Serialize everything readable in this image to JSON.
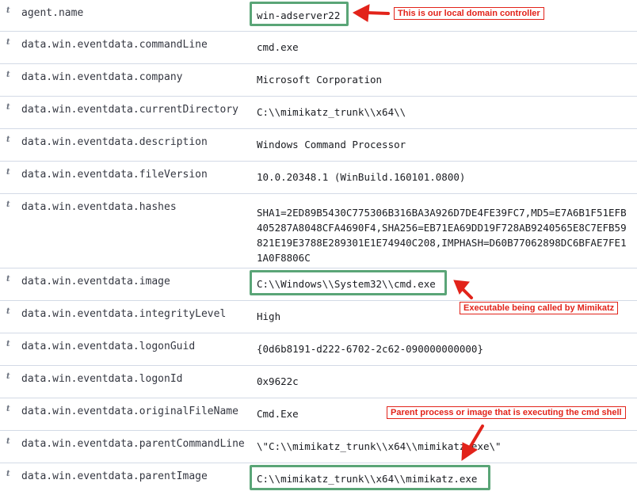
{
  "type_icon": "t",
  "rows": [
    {
      "field": "agent.name",
      "value": "win-adserver22"
    },
    {
      "field": "data.win.eventdata.commandLine",
      "value": "cmd.exe"
    },
    {
      "field": "data.win.eventdata.company",
      "value": "Microsoft Corporation"
    },
    {
      "field": "data.win.eventdata.currentDirectory",
      "value": "C:\\\\mimikatz_trunk\\\\x64\\\\"
    },
    {
      "field": "data.win.eventdata.description",
      "value": "Windows Command Processor"
    },
    {
      "field": "data.win.eventdata.fileVersion",
      "value": "10.0.20348.1 (WinBuild.160101.0800)"
    },
    {
      "field": "data.win.eventdata.hashes",
      "value": "SHA1=2ED89B5430C775306B316BA3A926D7DE4FE39FC7,MD5=E7A6B1F51EFB405287A8048CFA4690F4,SHA256=EB71EA69DD19F728AB9240565E8C7EFB59821E19E3788E289301E1E74940C208,IMPHASH=D60B77062898DC6BFAE7FE11A0F8806C"
    },
    {
      "field": "data.win.eventdata.image",
      "value": "C:\\\\Windows\\\\System32\\\\cmd.exe"
    },
    {
      "field": "data.win.eventdata.integrityLevel",
      "value": "High"
    },
    {
      "field": "data.win.eventdata.logonGuid",
      "value": "{0d6b8191-d222-6702-2c62-090000000000}"
    },
    {
      "field": "data.win.eventdata.logonId",
      "value": "0x9622c"
    },
    {
      "field": "data.win.eventdata.originalFileName",
      "value": "Cmd.Exe"
    },
    {
      "field": "data.win.eventdata.parentCommandLine",
      "value": "\\\"C:\\\\mimikatz_trunk\\\\x64\\\\mimikatz.exe\\\""
    },
    {
      "field": "data.win.eventdata.parentImage",
      "value": "C:\\\\mimikatz_trunk\\\\x64\\\\mimikatz.exe"
    }
  ],
  "annotations": {
    "domain_controller": "This is our local domain controller",
    "executable": "Executable being called by Mimikatz",
    "parent_process": "Parent process or image that is executing the cmd shell"
  },
  "colors": {
    "highlight": "#5aa577",
    "annotation": "#e2231a"
  }
}
